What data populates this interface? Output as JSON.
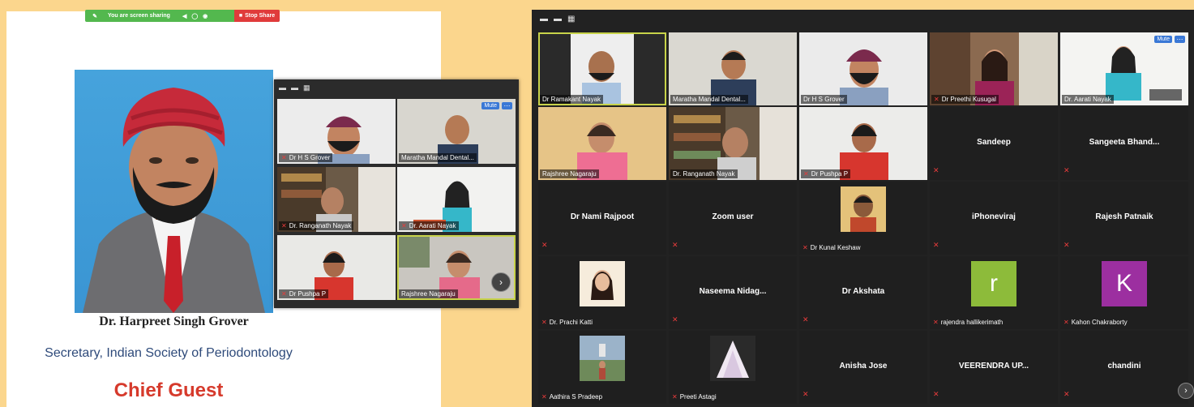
{
  "share_bar": {
    "status": "You are screen sharing",
    "stop": "Stop Share",
    "controls": "◀ ◯ ◉"
  },
  "slide": {
    "name": "Dr. Harpreet Singh Grover",
    "role": "Secretary, Indian Society of Periodontology",
    "title": "Chief Guest"
  },
  "mini_panel": {
    "mute": "Mute",
    "tiles": [
      {
        "label": "Dr H S Grover",
        "muted": true
      },
      {
        "label": "Maratha Mandal Dental...",
        "muted": false
      },
      {
        "label": "Dr. Ranganath Nayak",
        "muted": true
      },
      {
        "label": "Dr. Aarati Nayak",
        "muted": true
      },
      {
        "label": "Dr Pushpa P",
        "muted": true
      },
      {
        "label": "Rajshree Nagaraju",
        "muted": false
      }
    ]
  },
  "gallery": {
    "mute": "Mute",
    "video_tiles": [
      {
        "label": "Dr Ramakant Nayak",
        "muted": false
      },
      {
        "label": "Maratha Mandal Dental...",
        "muted": false
      },
      {
        "label": "Dr H S Grover",
        "muted": false
      },
      {
        "label": "Dr Preethi Kusugal",
        "muted": true
      },
      {
        "label": "Dr. Aarati Nayak",
        "muted": false
      },
      {
        "label": "Rajshree Nagaraju",
        "muted": false
      },
      {
        "label": "Dr. Ranganath Nayak",
        "muted": false
      },
      {
        "label": "Dr Pushpa P",
        "muted": true
      }
    ],
    "name_tiles": [
      "Sandeep",
      "Sangeeta Bhand...",
      "Dr Nami Rajpoot",
      "Zoom user",
      "iPhoneviraj",
      "Rajesh Patnaik",
      "Naseema Nidag...",
      "Dr Akshata",
      "Anisha Jose",
      "VEERENDRA UP...",
      "chandini"
    ],
    "avatar_tiles": [
      {
        "label": "Dr Kunal Keshaw"
      },
      {
        "label": "Dr. Prachi Katti"
      },
      {
        "label": "rajendra hallikerimath",
        "letter": "r",
        "color": "#8dbb3a"
      },
      {
        "label": "Kahon Chakraborty",
        "letter": "K",
        "color": "#9c2fa0"
      },
      {
        "label": "Aathira S Pradeep"
      },
      {
        "label": "Preeti Astagi"
      }
    ]
  }
}
